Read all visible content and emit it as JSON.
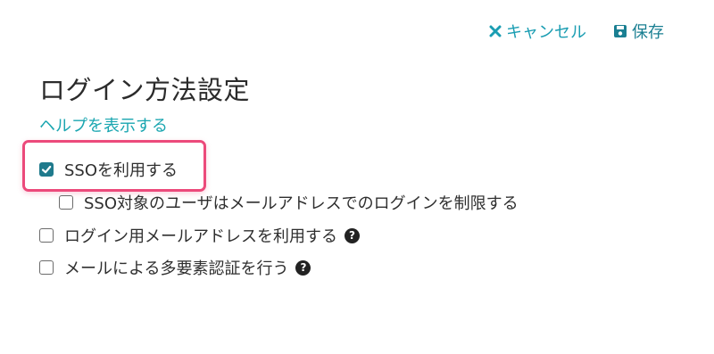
{
  "toolbar": {
    "cancel_label": "キャンセル",
    "save_label": "保存"
  },
  "title": "ログイン方法設定",
  "help_link": "ヘルプを表示する",
  "options": [
    {
      "label": "SSOを利用する",
      "checked": true
    },
    {
      "label": "SSO対象のユーザはメールアドレスでのログインを制限する",
      "checked": false
    },
    {
      "label": "ログイン用メールアドレスを利用する",
      "checked": false
    },
    {
      "label": "メールによる多要素認証を行う",
      "checked": false
    }
  ],
  "colors": {
    "accent": "#1aa6b0",
    "checkbox_checked": "#1f7a8c",
    "highlight": "#ec4a7b"
  }
}
